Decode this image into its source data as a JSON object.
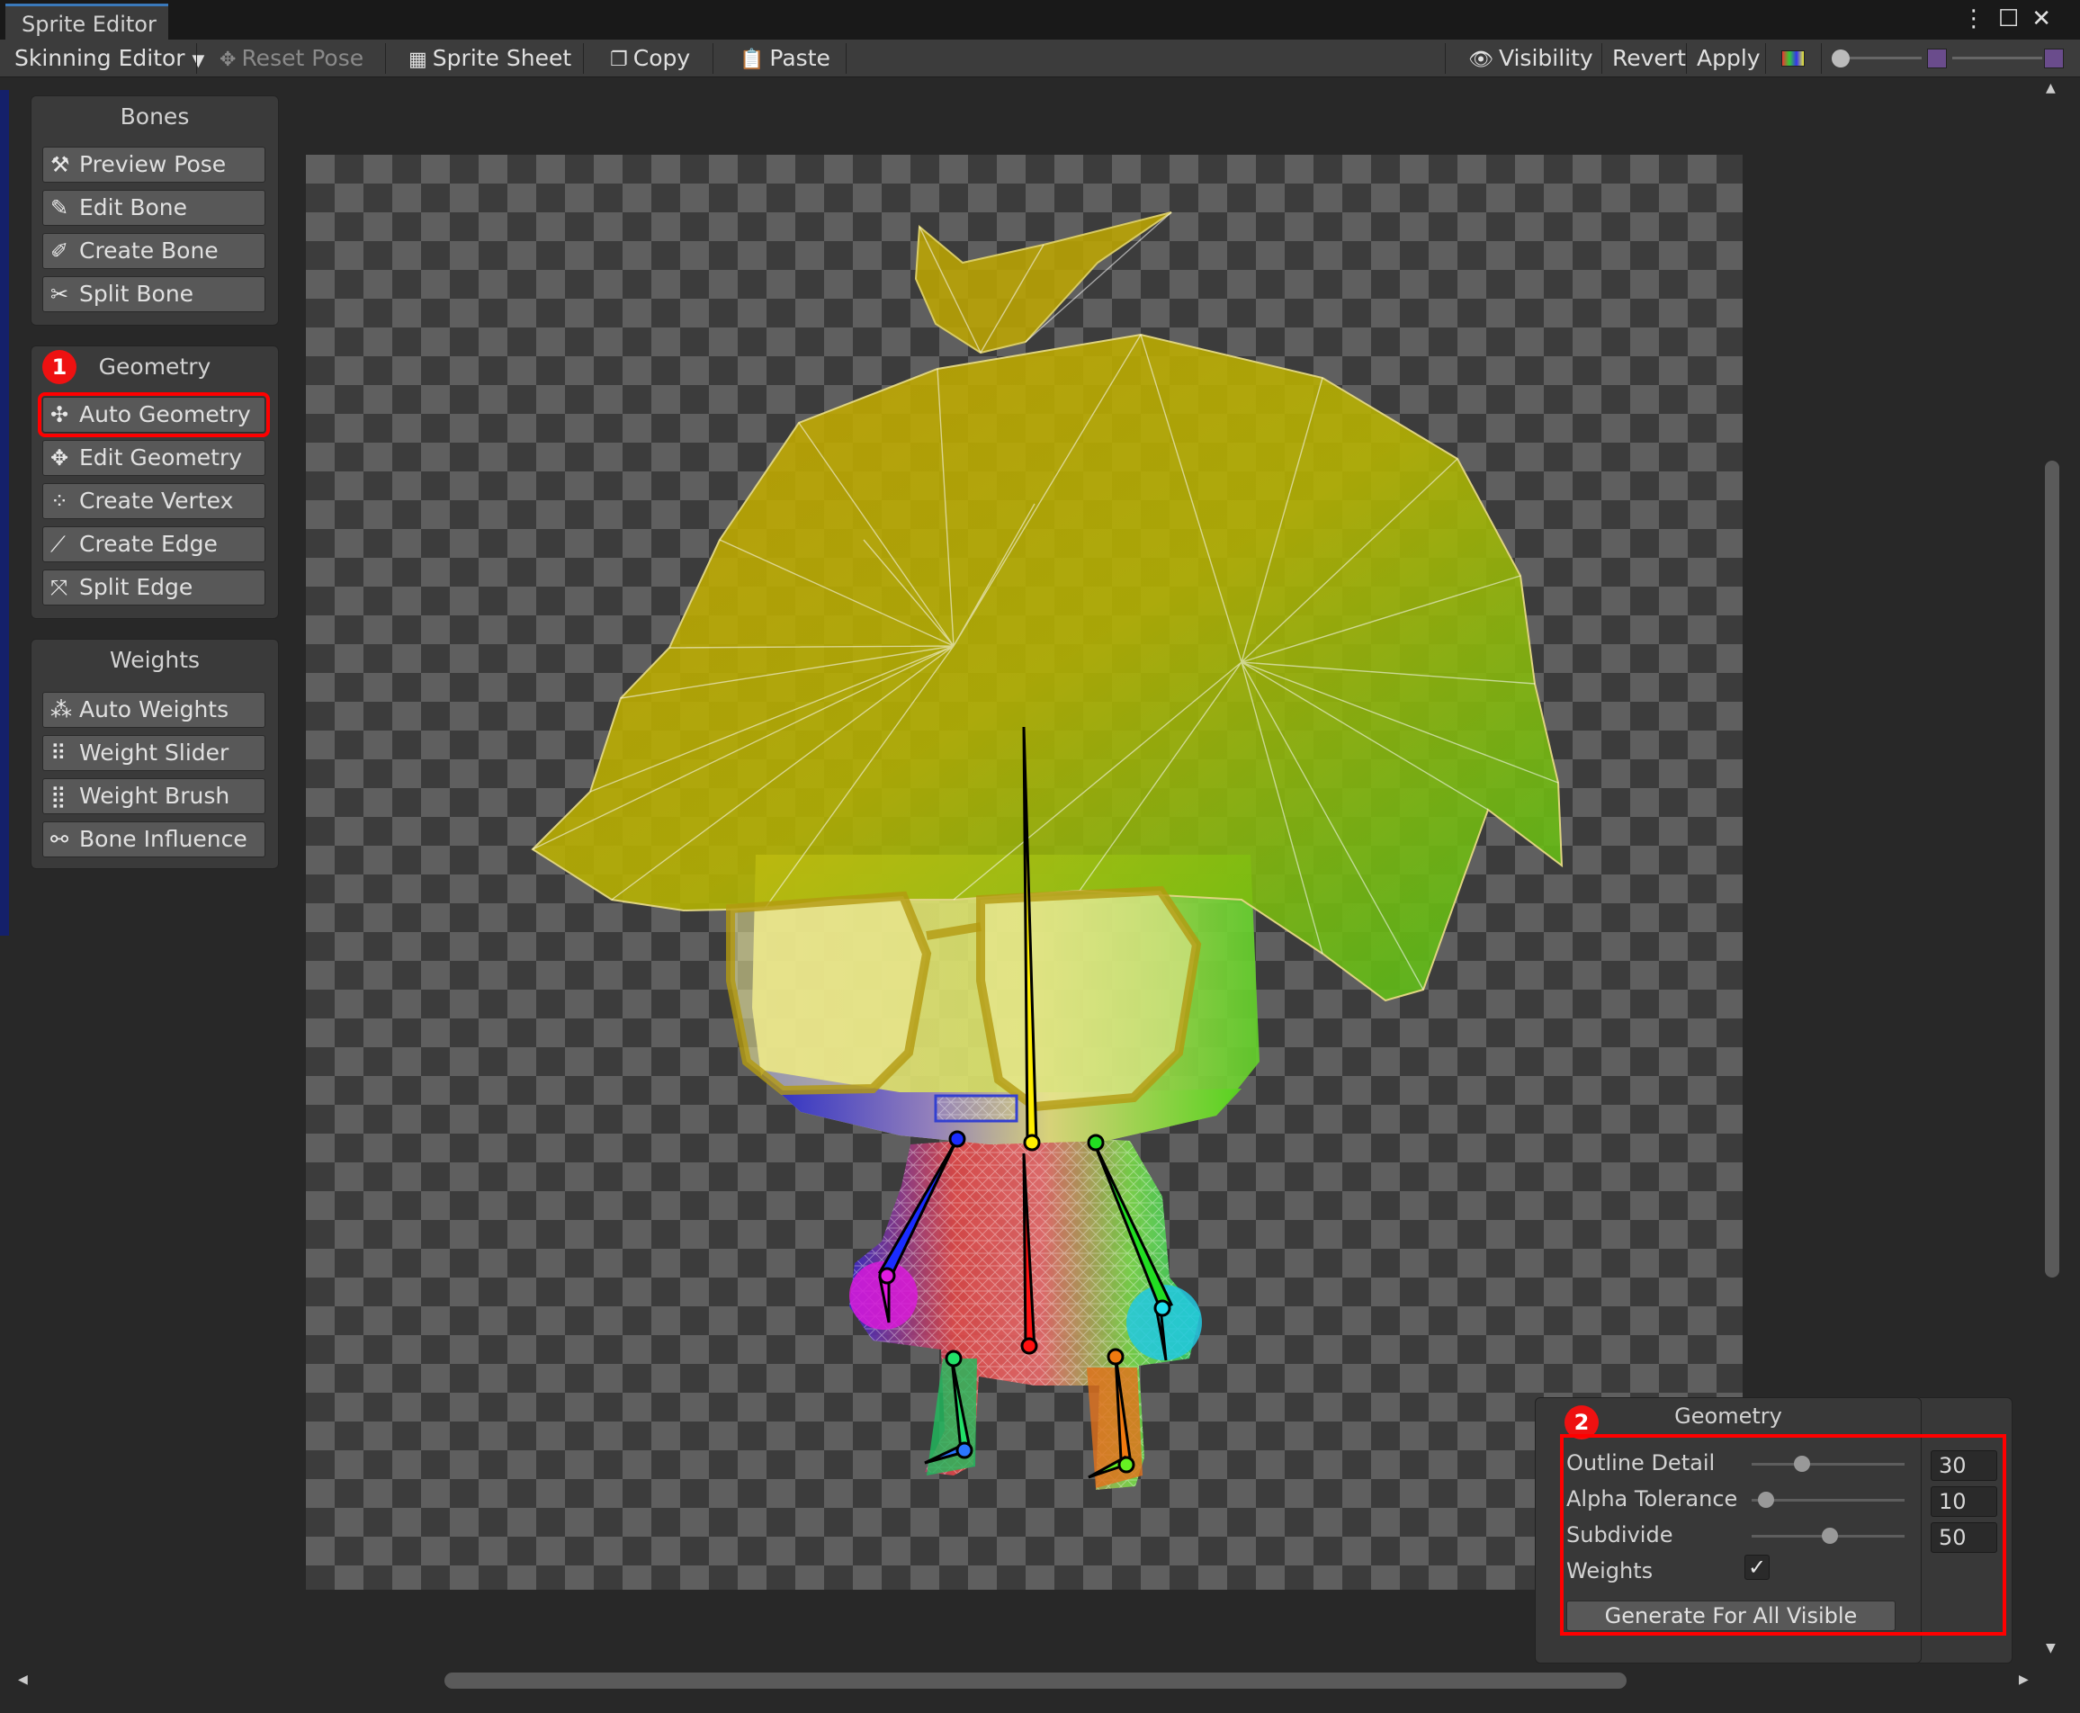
{
  "window": {
    "tab_title": "Sprite Editor"
  },
  "toolbar": {
    "mode_dropdown": "Skinning Editor",
    "reset_pose": "Reset Pose",
    "sprite_sheet": "Sprite Sheet",
    "copy": "Copy",
    "paste": "Paste",
    "visibility": "Visibility",
    "revert": "Revert",
    "apply": "Apply"
  },
  "bones_panel": {
    "title": "Bones",
    "buttons": [
      "Preview Pose",
      "Edit Bone",
      "Create Bone",
      "Split Bone"
    ]
  },
  "geometry_panel": {
    "title": "Geometry",
    "badge": "1",
    "buttons": [
      "Auto Geometry",
      "Edit Geometry",
      "Create Vertex",
      "Create Edge",
      "Split Edge"
    ]
  },
  "weights_panel": {
    "title": "Weights",
    "buttons": [
      "Auto Weights",
      "Weight Slider",
      "Weight Brush",
      "Bone Influence"
    ]
  },
  "auto_geometry": {
    "title": "Geometry",
    "badge": "2",
    "outline_detail_label": "Outline Detail",
    "outline_detail_value": "30",
    "alpha_tolerance_label": "Alpha Tolerance",
    "alpha_tolerance_value": "10",
    "subdivide_label": "Subdivide",
    "subdivide_value": "50",
    "weights_label": "Weights",
    "weights_checked": true,
    "generate_button": "Generate For All Visible"
  },
  "colors": {
    "highlight": "#ff0000",
    "tab_accent": "#3a79bb"
  }
}
